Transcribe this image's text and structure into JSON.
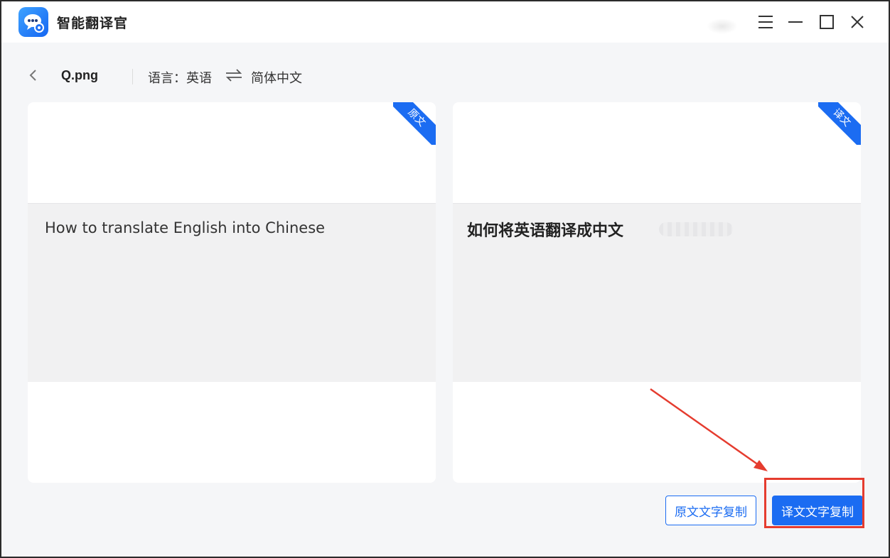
{
  "app": {
    "title": "智能翻译官",
    "logo_icon": "chat-robot-icon",
    "accent_color": "#1b6cf2"
  },
  "window_controls": {
    "menu_icon": "hamburger-menu-icon",
    "minimize_icon": "minimize-icon",
    "maximize_icon": "maximize-icon",
    "close_icon": "close-icon"
  },
  "toolbar": {
    "file_name": "Q.png",
    "language_label": "语言：英语",
    "target_language": "简体中文"
  },
  "panels": {
    "source": {
      "ribbon_label": "原文",
      "text": "How to translate English into Chinese"
    },
    "target": {
      "ribbon_label": "译文",
      "text": "如何将英语翻译成中文"
    }
  },
  "actions": {
    "copy_source_label": "原文文字复制",
    "copy_target_label": "译文文字复制"
  },
  "annotation": {
    "color": "#e53c2f"
  }
}
